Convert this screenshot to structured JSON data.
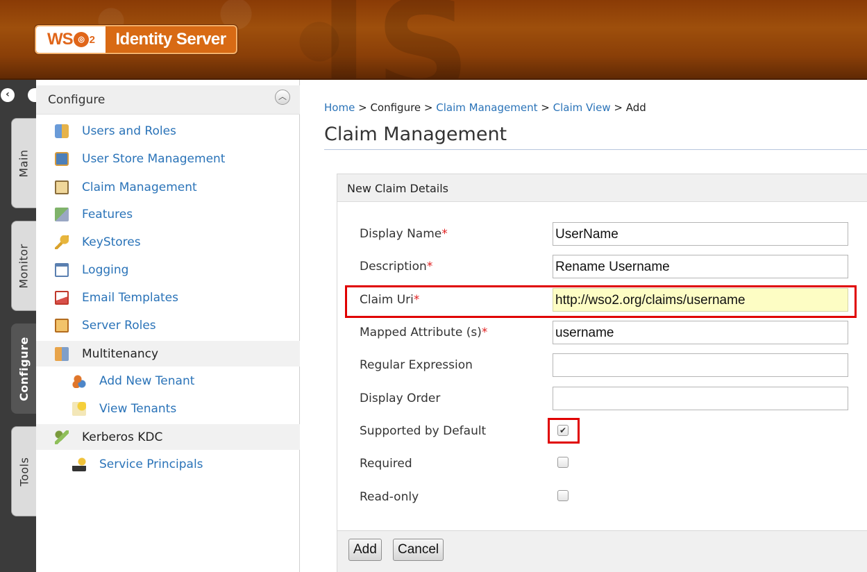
{
  "header": {
    "logo_brand": "WSO2",
    "product_name": "Identity Server"
  },
  "vertical_tabs": [
    {
      "label": "Main",
      "active": false
    },
    {
      "label": "Monitor",
      "active": false
    },
    {
      "label": "Configure",
      "active": true
    },
    {
      "label": "Tools",
      "active": false
    }
  ],
  "sidebar": {
    "section_title": "Configure",
    "items": [
      {
        "label": "Users and Roles",
        "icon": "users-roles-icon"
      },
      {
        "label": "User Store Management",
        "icon": "user-store-icon"
      },
      {
        "label": "Claim Management",
        "icon": "claim-icon"
      },
      {
        "label": "Features",
        "icon": "features-icon"
      },
      {
        "label": "KeyStores",
        "icon": "key-icon"
      },
      {
        "label": "Logging",
        "icon": "logging-icon"
      },
      {
        "label": "Email Templates",
        "icon": "email-icon"
      },
      {
        "label": "Server Roles",
        "icon": "server-roles-icon"
      },
      {
        "label": "Multitenancy",
        "icon": "multitenancy-icon"
      },
      {
        "label": "Add New Tenant",
        "icon": "add-tenant-icon"
      },
      {
        "label": "View Tenants",
        "icon": "view-tenants-icon"
      },
      {
        "label": "Kerberos KDC",
        "icon": "kerberos-icon"
      },
      {
        "label": "Service Principals",
        "icon": "service-principal-icon"
      }
    ]
  },
  "breadcrumb": {
    "home": "Home",
    "sep": ">",
    "configure": "Configure",
    "claim_management": "Claim Management",
    "claim_view": "Claim View",
    "add": "Add"
  },
  "page_title": "Claim Management",
  "form": {
    "panel_title": "New Claim Details",
    "required_mark": "*",
    "display_name_label": "Display Name",
    "display_name_value": "UserName",
    "description_label": "Description",
    "description_value": "Rename Username",
    "claim_uri_label": "Claim Uri",
    "claim_uri_value": "http://wso2.org/claims/username",
    "mapped_attr_label": "Mapped Attribute (s)",
    "mapped_attr_value": "username",
    "regex_label": "Regular Expression",
    "regex_value": "",
    "display_order_label": "Display Order",
    "display_order_value": "",
    "supported_label": "Supported by Default",
    "supported_checked": true,
    "required_label": "Required",
    "required_checked": false,
    "readonly_label": "Read-only",
    "readonly_checked": false
  },
  "buttons": {
    "add": "Add",
    "cancel": "Cancel"
  },
  "colors": {
    "header": "#8a3b06",
    "link": "#2a73b8",
    "highlight_box": "#e00000",
    "field_highlight": "#fdfdc4"
  }
}
